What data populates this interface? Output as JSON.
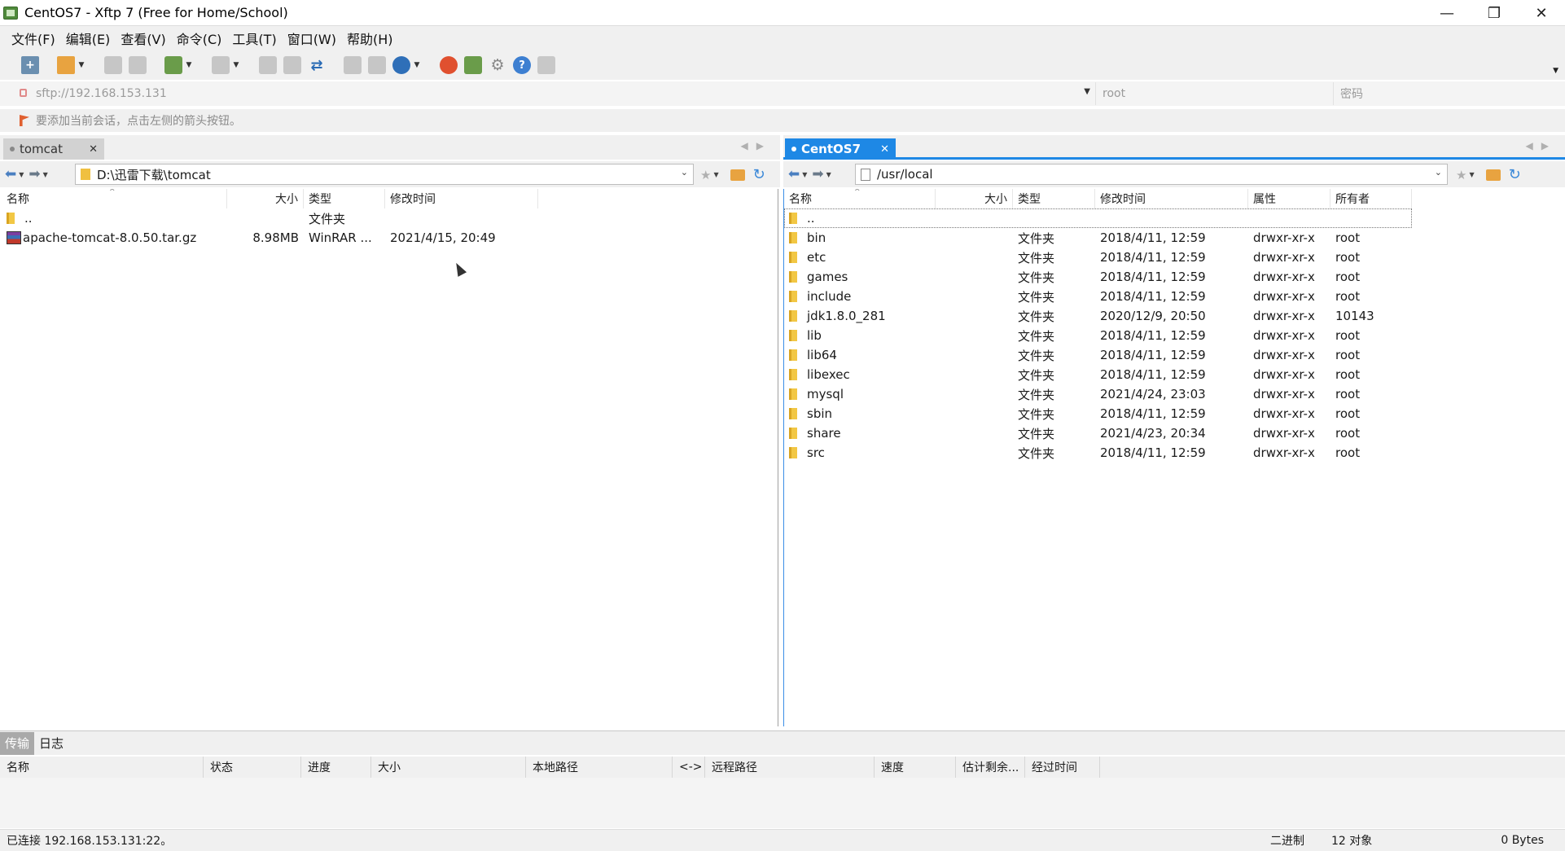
{
  "window": {
    "title": "CentOS7 - Xftp 7 (Free for Home/School)",
    "controls": {
      "minimize": "—",
      "restore": "❐",
      "close": "✕"
    }
  },
  "menu": [
    "文件(F)",
    "编辑(E)",
    "查看(V)",
    "命令(C)",
    "工具(T)",
    "窗口(W)",
    "帮助(H)"
  ],
  "address": {
    "host_placeholder": "sftp://192.168.153.131",
    "user_placeholder": "root",
    "password_placeholder": "密码"
  },
  "hint": "要添加当前会话，点击左侧的箭头按钮。",
  "left_pane": {
    "tab_label": "tomcat",
    "path": "D:\\迅雷下载\\tomcat",
    "columns": [
      "名称",
      "大小",
      "类型",
      "修改时间"
    ],
    "rows": [
      {
        "name": "..",
        "size": "",
        "type": "文件夹",
        "modified": "",
        "icon": "folder-icon"
      },
      {
        "name": "apache-tomcat-8.0.50.tar.gz",
        "size": "8.98MB",
        "type": "WinRAR ...",
        "modified": "2021/4/15, 20:49",
        "icon": "archive-file-icon"
      }
    ]
  },
  "right_pane": {
    "tab_label": "CentOS7",
    "path": "/usr/local",
    "columns": [
      "名称",
      "大小",
      "类型",
      "修改时间",
      "属性",
      "所有者"
    ],
    "rows": [
      {
        "name": "..",
        "type": "",
        "modified": "",
        "perm": "",
        "owner": ""
      },
      {
        "name": "bin",
        "type": "文件夹",
        "modified": "2018/4/11, 12:59",
        "perm": "drwxr-xr-x",
        "owner": "root"
      },
      {
        "name": "etc",
        "type": "文件夹",
        "modified": "2018/4/11, 12:59",
        "perm": "drwxr-xr-x",
        "owner": "root"
      },
      {
        "name": "games",
        "type": "文件夹",
        "modified": "2018/4/11, 12:59",
        "perm": "drwxr-xr-x",
        "owner": "root"
      },
      {
        "name": "include",
        "type": "文件夹",
        "modified": "2018/4/11, 12:59",
        "perm": "drwxr-xr-x",
        "owner": "root"
      },
      {
        "name": "jdk1.8.0_281",
        "type": "文件夹",
        "modified": "2020/12/9, 20:50",
        "perm": "drwxr-xr-x",
        "owner": "10143"
      },
      {
        "name": "lib",
        "type": "文件夹",
        "modified": "2018/4/11, 12:59",
        "perm": "drwxr-xr-x",
        "owner": "root"
      },
      {
        "name": "lib64",
        "type": "文件夹",
        "modified": "2018/4/11, 12:59",
        "perm": "drwxr-xr-x",
        "owner": "root"
      },
      {
        "name": "libexec",
        "type": "文件夹",
        "modified": "2018/4/11, 12:59",
        "perm": "drwxr-xr-x",
        "owner": "root"
      },
      {
        "name": "mysql",
        "type": "文件夹",
        "modified": "2021/4/24, 23:03",
        "perm": "drwxr-xr-x",
        "owner": "root"
      },
      {
        "name": "sbin",
        "type": "文件夹",
        "modified": "2018/4/11, 12:59",
        "perm": "drwxr-xr-x",
        "owner": "root"
      },
      {
        "name": "share",
        "type": "文件夹",
        "modified": "2021/4/23, 20:34",
        "perm": "drwxr-xr-x",
        "owner": "root"
      },
      {
        "name": "src",
        "type": "文件夹",
        "modified": "2018/4/11, 12:59",
        "perm": "drwxr-xr-x",
        "owner": "root"
      }
    ]
  },
  "bottom": {
    "tabs": [
      "传输",
      "日志"
    ],
    "columns": [
      "名称",
      "状态",
      "进度",
      "大小",
      "本地路径",
      "<->",
      "远程路径",
      "速度",
      "估计剩余...",
      "经过时间"
    ]
  },
  "status": {
    "connection": "已连接 192.168.153.131:22。",
    "mode": "二进制",
    "objects": "12 对象",
    "bytes": "0 Bytes"
  },
  "colors": {
    "accent": "#1e88e5",
    "folder": "#f2c744"
  }
}
